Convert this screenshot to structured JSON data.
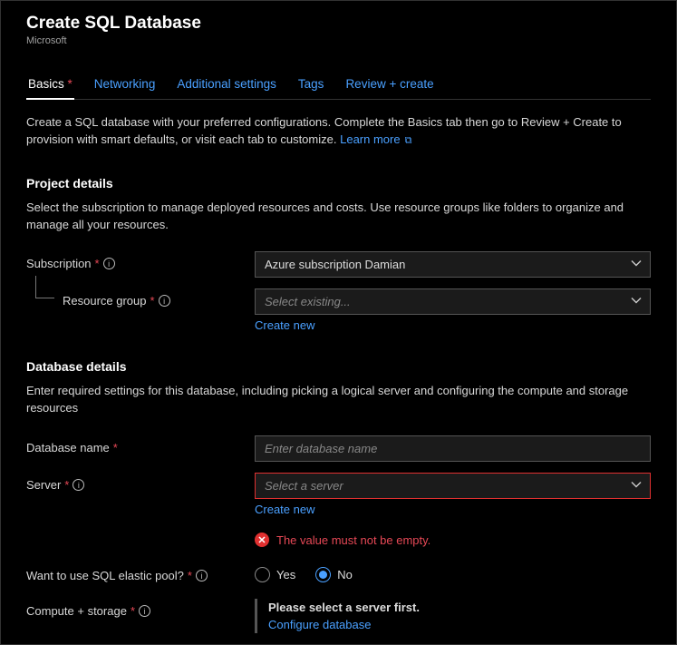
{
  "header": {
    "title": "Create SQL Database",
    "subtitle": "Microsoft"
  },
  "tabs": [
    {
      "label": "Basics",
      "active": true,
      "required": true
    },
    {
      "label": "Networking"
    },
    {
      "label": "Additional settings"
    },
    {
      "label": "Tags"
    },
    {
      "label": "Review + create"
    }
  ],
  "intro": {
    "text": "Create a SQL database with your preferred configurations. Complete the Basics tab then go to Review + Create to provision with smart defaults, or visit each tab to customize.",
    "learn_more": "Learn more"
  },
  "project": {
    "title": "Project details",
    "desc": "Select the subscription to manage deployed resources and costs. Use resource groups like folders to organize and manage all your resources.",
    "subscription_label": "Subscription",
    "subscription_value": "Azure subscription Damian",
    "resource_group_label": "Resource group",
    "resource_group_placeholder": "Select existing...",
    "create_new": "Create new"
  },
  "database": {
    "title": "Database details",
    "desc": "Enter required settings for this database, including picking a logical server and configuring the compute and storage resources",
    "name_label": "Database name",
    "name_placeholder": "Enter database name",
    "server_label": "Server",
    "server_placeholder": "Select a server",
    "create_new": "Create new",
    "error_msg": "The value must not be empty.",
    "elastic_label": "Want to use SQL elastic pool?",
    "elastic_yes": "Yes",
    "elastic_no": "No",
    "compute_label": "Compute + storage",
    "compute_msg": "Please select a server first.",
    "configure_link": "Configure database"
  }
}
